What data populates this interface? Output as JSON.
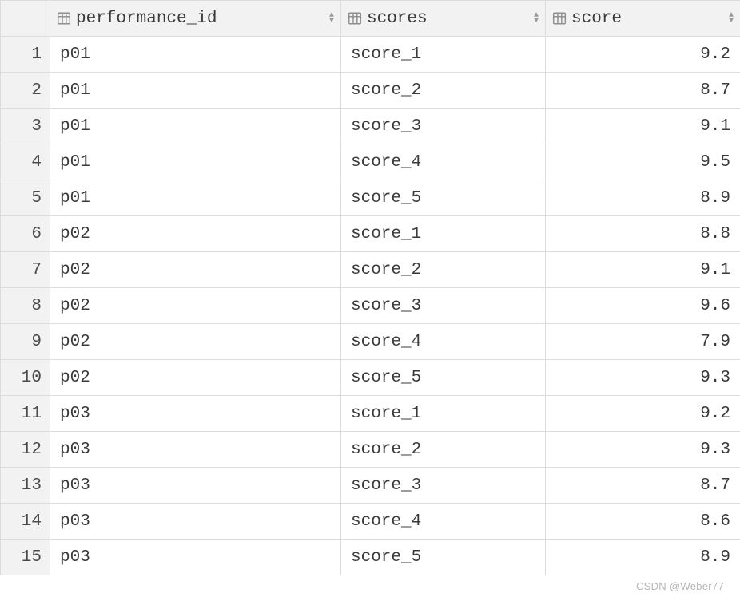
{
  "columns": {
    "performance_id": {
      "label": "performance_id",
      "align": "left"
    },
    "scores": {
      "label": "scores",
      "align": "left"
    },
    "score": {
      "label": "score",
      "align": "right"
    }
  },
  "rows": [
    {
      "n": "1",
      "performance_id": "p01",
      "scores": "score_1",
      "score": "9.2"
    },
    {
      "n": "2",
      "performance_id": "p01",
      "scores": "score_2",
      "score": "8.7"
    },
    {
      "n": "3",
      "performance_id": "p01",
      "scores": "score_3",
      "score": "9.1"
    },
    {
      "n": "4",
      "performance_id": "p01",
      "scores": "score_4",
      "score": "9.5"
    },
    {
      "n": "5",
      "performance_id": "p01",
      "scores": "score_5",
      "score": "8.9"
    },
    {
      "n": "6",
      "performance_id": "p02",
      "scores": "score_1",
      "score": "8.8"
    },
    {
      "n": "7",
      "performance_id": "p02",
      "scores": "score_2",
      "score": "9.1"
    },
    {
      "n": "8",
      "performance_id": "p02",
      "scores": "score_3",
      "score": "9.6"
    },
    {
      "n": "9",
      "performance_id": "p02",
      "scores": "score_4",
      "score": "7.9"
    },
    {
      "n": "10",
      "performance_id": "p02",
      "scores": "score_5",
      "score": "9.3"
    },
    {
      "n": "11",
      "performance_id": "p03",
      "scores": "score_1",
      "score": "9.2"
    },
    {
      "n": "12",
      "performance_id": "p03",
      "scores": "score_2",
      "score": "9.3"
    },
    {
      "n": "13",
      "performance_id": "p03",
      "scores": "score_3",
      "score": "8.7"
    },
    {
      "n": "14",
      "performance_id": "p03",
      "scores": "score_4",
      "score": "8.6"
    },
    {
      "n": "15",
      "performance_id": "p03",
      "scores": "score_5",
      "score": "8.9"
    }
  ],
  "watermark": "CSDN @Weber77"
}
